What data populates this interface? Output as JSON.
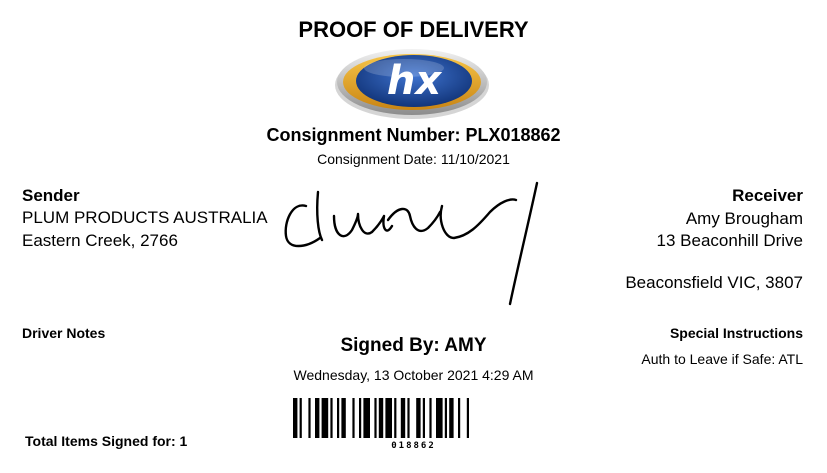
{
  "header": {
    "title": "PROOF OF DELIVERY",
    "logo_text": "hx",
    "consignment_number": "Consignment Number: PLX018862",
    "consignment_date": "Consignment Date: 11/10/2021"
  },
  "sender": {
    "heading": "Sender",
    "line1": "PLUM PRODUCTS AUSTRALIA",
    "line2": "Eastern Creek, 2766"
  },
  "receiver": {
    "heading": "Receiver",
    "line1": "Amy Brougham",
    "line2": "13 Beaconhill Drive",
    "line3": "Beaconsfield VIC, 3807"
  },
  "driver_notes": {
    "heading": "Driver Notes"
  },
  "special_instructions": {
    "heading": "Special Instructions",
    "value": "Auth to Leave if Safe: ATL"
  },
  "signature": {
    "signed_by": "Signed By: AMY",
    "signed_date": "Wednesday, 13 October 2021 4:29 AM"
  },
  "barcode": {
    "value": "018862"
  },
  "footer": {
    "total_items": "Total Items Signed for: 1"
  },
  "colors": {
    "logo_blue": "#1c4a9c",
    "logo_gold": "#e8a623",
    "text": "#000000"
  }
}
